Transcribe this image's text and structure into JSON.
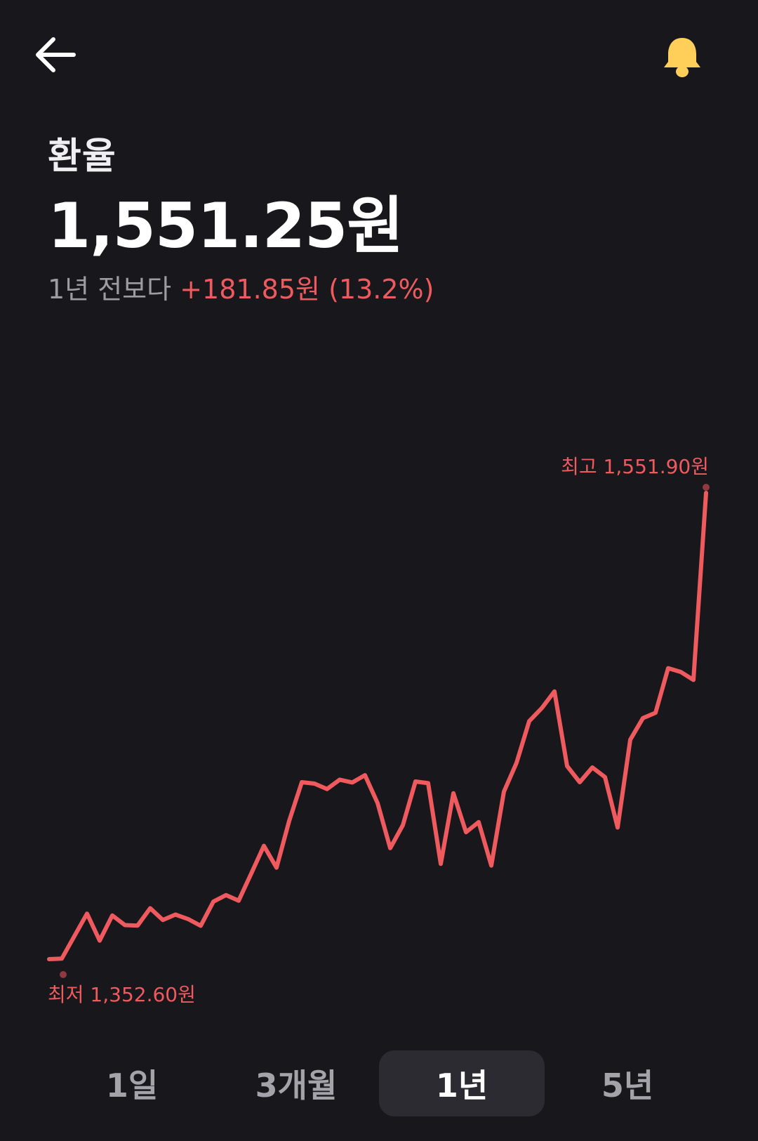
{
  "header": {
    "title": "환율",
    "value": "1,551.25원",
    "change_prefix": "1년 전보다",
    "change_amount": "+181.85원",
    "change_percent": "(13.2%)"
  },
  "icons": {
    "back": "arrow-left-icon",
    "alert": "bell-icon"
  },
  "colors": {
    "background": "#18171c",
    "line": "#ef5a5f",
    "bell": "#ffcf5a",
    "muted_text": "#9d9ca3",
    "active_tab_bg": "#2b2b31"
  },
  "chart_data": {
    "type": "line",
    "ylim": [
      1352.6,
      1551.9
    ],
    "max_label": "최고 1,551.90원",
    "min_label": "최저 1,352.60원",
    "series": [
      {
        "values": [
          1353.2,
          1353.4,
          1363,
          1372.6,
          1361.1,
          1371.8,
          1367.7,
          1367.5,
          1374.9,
          1369.9,
          1372.2,
          1370.3,
          1367.4,
          1377.7,
          1380.5,
          1378.1,
          1389.7,
          1401.5,
          1392.2,
          1412.1,
          1428.6,
          1428,
          1425.7,
          1429.7,
          1428.5,
          1431.6,
          1419.7,
          1400.5,
          1410.3,
          1428.9,
          1428.2,
          1393.8,
          1423.9,
          1407.3,
          1411.6,
          1393.1,
          1424.6,
          1436.9,
          1454.6,
          1460.2,
          1467.3,
          1435.5,
          1428.6,
          1434.9,
          1430.8,
          1409.3,
          1446.7,
          1455.9,
          1458.2,
          1477.2,
          1475.6,
          1472.2,
          1551.9
        ]
      }
    ]
  },
  "tabs": [
    {
      "label": "1일",
      "active": false
    },
    {
      "label": "3개월",
      "active": false
    },
    {
      "label": "1년",
      "active": true
    },
    {
      "label": "5년",
      "active": false
    }
  ]
}
